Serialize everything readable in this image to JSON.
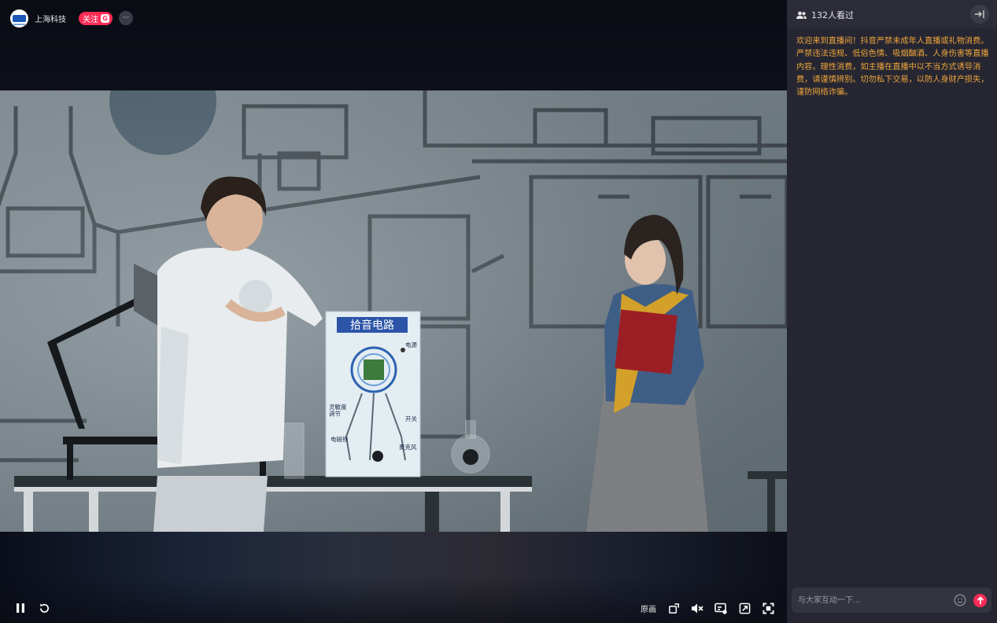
{
  "anchor": {
    "name": "上海科技",
    "follow_label": "关注",
    "follow_badge": "G",
    "more_label": "···"
  },
  "video": {
    "board_title": "拾音电路",
    "board_labels": {
      "power": "电源",
      "sensitivity": "灵敏度\n调节",
      "switch": "开关",
      "coil": "电磁铁",
      "mic": "麦克风"
    }
  },
  "controls": {
    "original_label": "原画",
    "left_icons": [
      "pause-icon",
      "refresh-icon"
    ],
    "right_icons": [
      "rotate-screen-icon",
      "mute-icon",
      "subtitle-icon",
      "picture-in-picture-icon",
      "fullscreen-icon"
    ]
  },
  "side": {
    "viewers_text": "132人看过",
    "notice": "欢迎来到直播间！抖音严禁未成年人直播或礼物消费。严禁违法违规、低俗色情、吸烟酗酒、人身伤害等直播内容。理性消费，如主播在直播中以不当方式诱导消费，请谨慎辨别。切勿私下交易，以防人身财产损失，谨防网络诈骗。",
    "chat_placeholder": "与大家互动一下..."
  },
  "colors": {
    "accent": "#fe2c55",
    "notice": "#f0a53a",
    "panel_bg": "#252632"
  }
}
